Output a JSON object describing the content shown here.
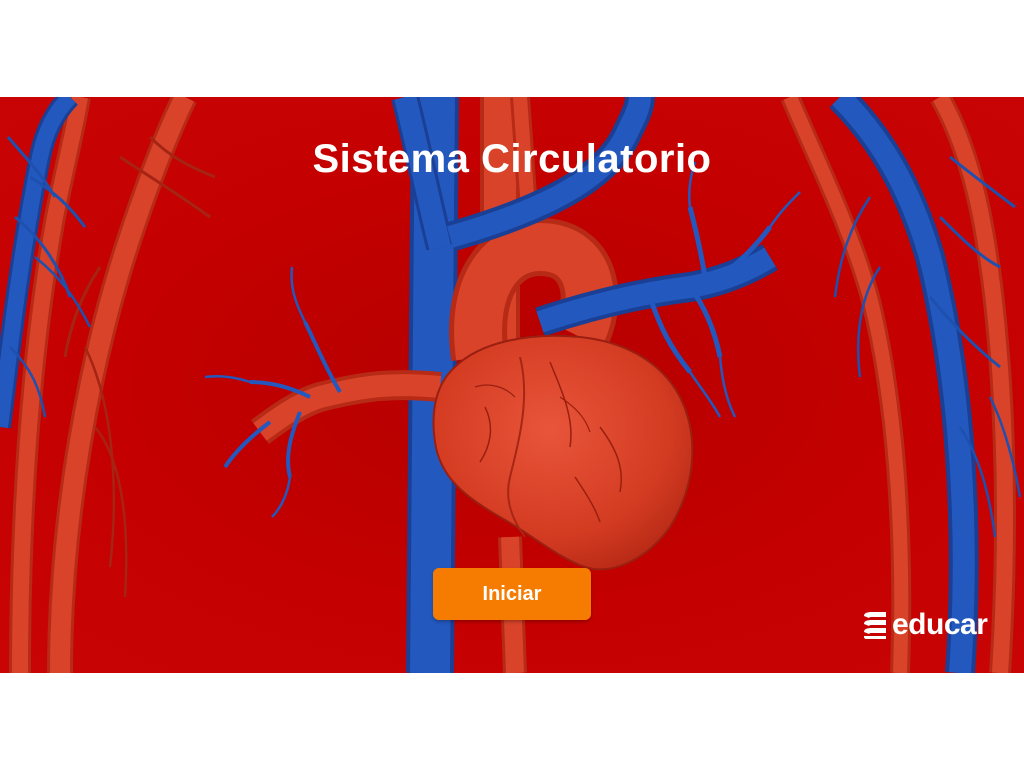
{
  "title": "Sistema Circulatorio",
  "start_button": {
    "label": "Iniciar"
  },
  "brand": {
    "name": "educar"
  },
  "colors": {
    "background": "#c40000",
    "vein": "#1d4fae",
    "artery": "#d63a1e",
    "heart": "#dc4126",
    "button": "#f57c00",
    "text": "#ffffff"
  },
  "icons": [
    "heart-illustration",
    "educar-logo-icon"
  ]
}
